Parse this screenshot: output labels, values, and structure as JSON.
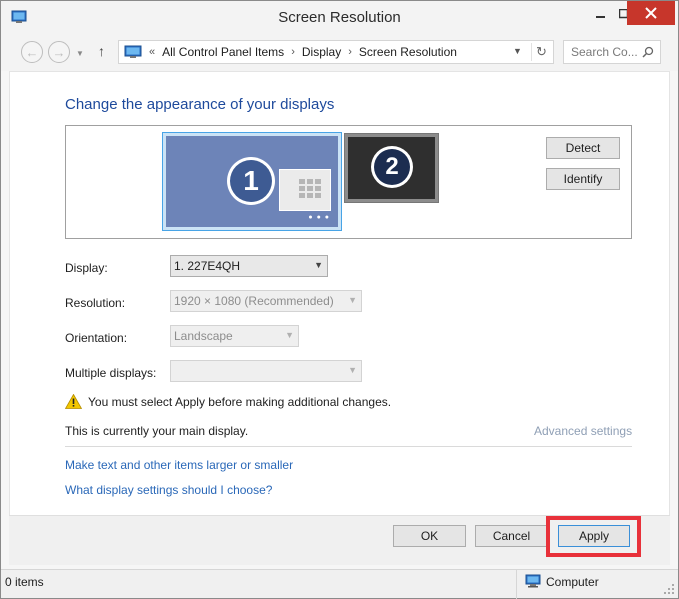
{
  "window": {
    "title": "Screen Resolution"
  },
  "address": {
    "overflow": "«",
    "items": [
      "All Control Panel Items",
      "Display",
      "Screen Resolution"
    ],
    "search_placeholder": "Search Co..."
  },
  "content": {
    "heading": "Change the appearance of your displays",
    "monitor1_number": "1",
    "monitor2_number": "2",
    "detect_label": "Detect",
    "identify_label": "Identify",
    "display_label": "Display:",
    "display_value": "1. 227E4QH",
    "resolution_label": "Resolution:",
    "resolution_value": "1920 × 1080 (Recommended)",
    "orientation_label": "Orientation:",
    "orientation_value": "Landscape",
    "multiple_label": "Multiple displays:",
    "multiple_value": "",
    "warning_text": "You must select Apply before making additional changes.",
    "main_display_text": "This is currently your main display.",
    "advanced_link": "Advanced settings",
    "link1": "Make text and other items larger or smaller",
    "link2": "What display settings should I choose?"
  },
  "footer": {
    "ok_label": "OK",
    "cancel_label": "Cancel",
    "apply_label": "Apply"
  },
  "status": {
    "items": "0 items",
    "location": "Computer"
  },
  "colors": {
    "heading": "#1e4a9c",
    "link": "#2a68b8",
    "close": "#c7362b",
    "highlight": "#e8313a"
  }
}
